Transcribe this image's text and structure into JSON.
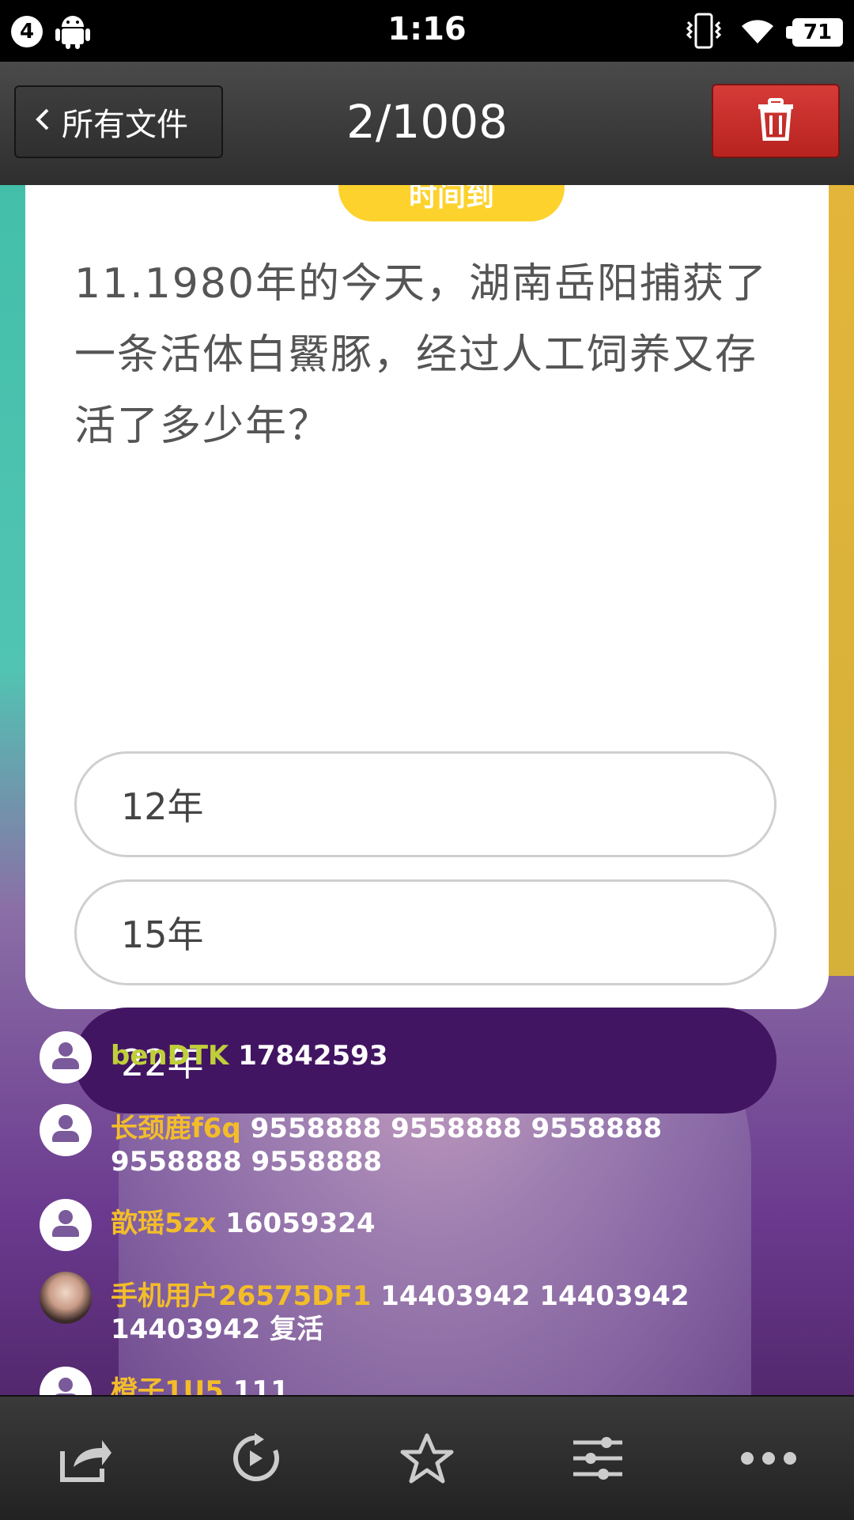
{
  "status_bar": {
    "notification_count": "4",
    "time": "1:16",
    "battery": "71"
  },
  "toolbar": {
    "back_label": "所有文件",
    "counter": "2/1008"
  },
  "quiz": {
    "time_tag": "时间到",
    "question": "11.1980年的今天，湖南岳阳捕获了一条活体白鱀豚，经过人工饲养又存活了多少年？",
    "options": [
      "12年",
      "15年",
      "22年"
    ],
    "selected_index": 2
  },
  "comments": [
    {
      "name": "benDTK",
      "text": " 17842593"
    },
    {
      "name": "长颈鹿f6q",
      "text": " 9558888 9558888 9558888 9558888 9558888"
    },
    {
      "name": "歆瑶5zx",
      "text": " 16059324"
    },
    {
      "name": "手机用户26575DF1",
      "text": " 14403942 14403942 14403942 复活"
    },
    {
      "name": "橙子1U5",
      "text": " 111"
    }
  ],
  "bottom_bar": {
    "icons": [
      "share-icon",
      "rotate-icon",
      "star-icon",
      "adjust-icon",
      "more-icon"
    ]
  },
  "colors": {
    "accent_purple": "#421562",
    "trash_red": "#c92b28",
    "time_yellow": "#fdd22c",
    "name_yellow": "#f3bd2a"
  }
}
